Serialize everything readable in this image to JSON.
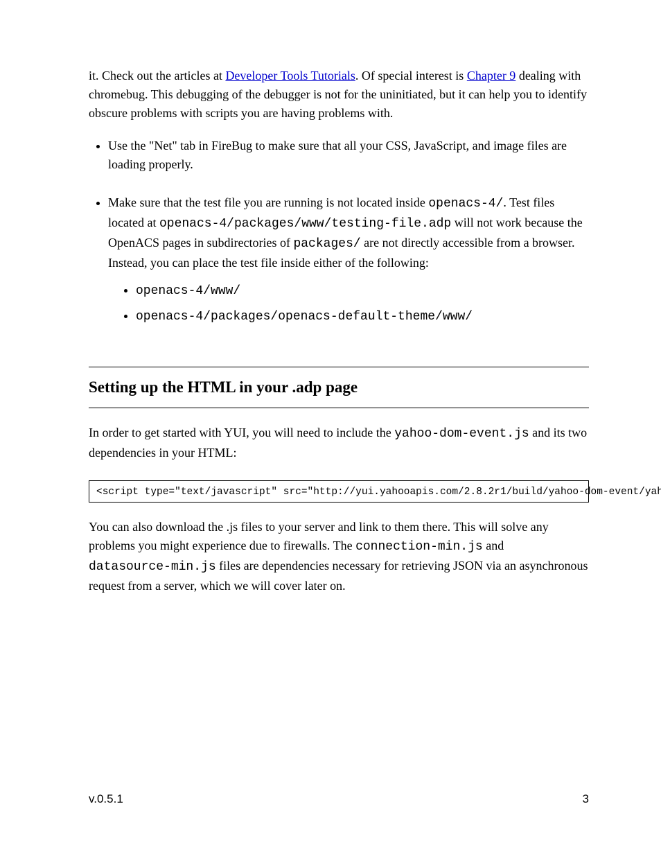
{
  "intro": {
    "pre": "it. Check out the articles at ",
    "link1_text": "Developer Tools Tutorials",
    "link1_href": "#",
    "mid": ". Of special interest is ",
    "link2_text": "Chapter 9",
    "link2_href": "#",
    "post": " dealing with chromebug. This debugging of the debugger is not for the uninitiated, but it can help you to identify obscure problems with scripts you are having problems with."
  },
  "bullets": [
    {
      "type": "plain",
      "text": "Use the \"Net\" tab in FireBug to make sure that all your CSS, JavaScript, and image files are loading properly."
    },
    {
      "type": "testfolder",
      "prefix": "Make sure that the test file you are running is not located inside ",
      "code1": "openacs-4/",
      "mid1": ". Test files located at ",
      "code2": "openacs-4/packages/www/testing-file.adp",
      "mid2": " will not work because the OpenACS pages in subdirectories of ",
      "code3": "packages/",
      "mid3": " are not directly accessible from a browser. Instead, you can place the test file inside either of the following:",
      "sublist": [
        "openacs-4/www/",
        "openacs-4/packages/openacs-default-theme/www/"
      ]
    }
  ],
  "section_heading": "Setting up the HTML in your .adp page",
  "paragraphs": {
    "p1_pre": "In order to get started with YUI, you will need to include the ",
    "p1_code": "yahoo-dom-event.js",
    "p1_post": " and its two dependencies in your HTML:",
    "p2_pre": "You can also download the .js files to your server and link to them there. This will solve any problems you might experience due to firewalls. The ",
    "p2_code1": "connection-min.js",
    "p2_mid": " and ",
    "p2_code2": "datasource-min.js",
    "p2_post": " files are dependencies necessary for retrieving JSON via an asynchronous request from a server, which we will cover later on."
  },
  "code_snippet": "<script type=\"text/javascript\" src=\"http://yui.yahooapis.com/2.8.2r1/build/yahoo-dom-event/yahoo-",
  "footer": {
    "left": "v.0.5.1",
    "right": "3"
  }
}
